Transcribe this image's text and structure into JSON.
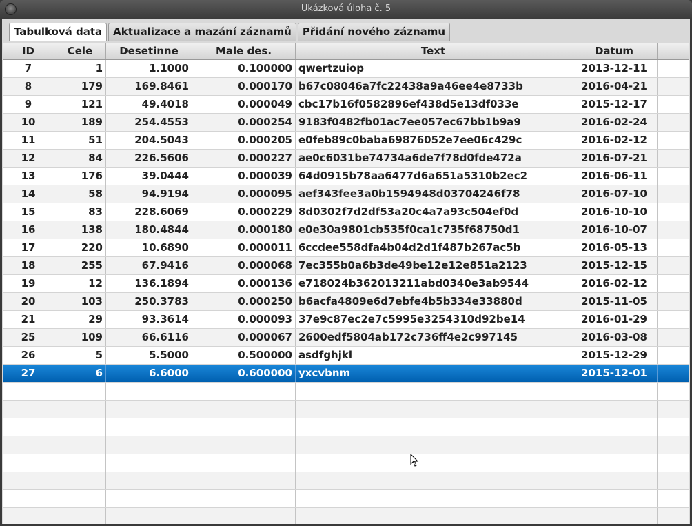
{
  "window": {
    "title": "Ukázková úloha č. 5"
  },
  "tabs": [
    {
      "label": "Tabulková data",
      "active": true
    },
    {
      "label": "Aktualizace a mazání záznamů"
    },
    {
      "label": "Přidání nového záznamu"
    }
  ],
  "table": {
    "columns": [
      "ID",
      "Cele",
      "Desetinne",
      "Male des.",
      "Text",
      "Datum"
    ],
    "rows": [
      [
        "7",
        "1",
        "1.1000",
        "0.100000",
        "qwertzuiop",
        "2013-12-11"
      ],
      [
        "8",
        "179",
        "169.8461",
        "0.000170",
        "b67c08046a7fc22438a9a46ee4e8733b",
        "2016-04-21"
      ],
      [
        "9",
        "121",
        "49.4018",
        "0.000049",
        "cbc17b16f0582896ef438d5e13df033e",
        "2015-12-17"
      ],
      [
        "10",
        "189",
        "254.4553",
        "0.000254",
        "9183f0482fb01ac7ee057ec67bb1b9a9",
        "2016-02-24"
      ],
      [
        "11",
        "51",
        "204.5043",
        "0.000205",
        "e0feb89c0baba69876052e7ee06c429c",
        "2016-02-12"
      ],
      [
        "12",
        "84",
        "226.5606",
        "0.000227",
        "ae0c6031be74734a6de7f78d0fde472a",
        "2016-07-21"
      ],
      [
        "13",
        "176",
        "39.0444",
        "0.000039",
        "64d0915b78aa6477d6a651a5310b2ec2",
        "2016-06-11"
      ],
      [
        "14",
        "58",
        "94.9194",
        "0.000095",
        "aef343fee3a0b1594948d03704246f78",
        "2016-07-10"
      ],
      [
        "15",
        "83",
        "228.6069",
        "0.000229",
        "8d0302f7d2df53a20c4a7a93c504ef0d",
        "2016-10-10"
      ],
      [
        "16",
        "138",
        "180.4844",
        "0.000180",
        "e0e30a9801cb535f0ca1c735f68750d1",
        "2016-10-07"
      ],
      [
        "17",
        "220",
        "10.6890",
        "0.000011",
        "6ccdee558dfa4b04d2d1f487b267ac5b",
        "2016-05-13"
      ],
      [
        "18",
        "255",
        "67.9416",
        "0.000068",
        "7ec355b0a6b3de49be12e12e851a2123",
        "2015-12-15"
      ],
      [
        "19",
        "12",
        "136.1894",
        "0.000136",
        "e718024b362013211abd0340e3ab9544",
        "2016-02-12"
      ],
      [
        "20",
        "103",
        "250.3783",
        "0.000250",
        "b6acfa4809e6d7ebfe4b5b334e33880d",
        "2015-11-05"
      ],
      [
        "21",
        "29",
        "93.3614",
        "0.000093",
        "37e9c87ec2e7c5995e3254310d92be14",
        "2016-01-29"
      ],
      [
        "25",
        "109",
        "66.6116",
        "0.000067",
        "2600edf5804ab172c736ff4e2c997145",
        "2016-03-08"
      ],
      [
        "26",
        "5",
        "5.5000",
        "0.500000",
        "asdfghjkl",
        "2015-12-29"
      ],
      [
        "27",
        "6",
        "6.6000",
        "0.600000",
        "yxcvbnm",
        "2015-12-01"
      ]
    ],
    "selected_row_id": "27",
    "selection_color": "#0a72c8"
  }
}
